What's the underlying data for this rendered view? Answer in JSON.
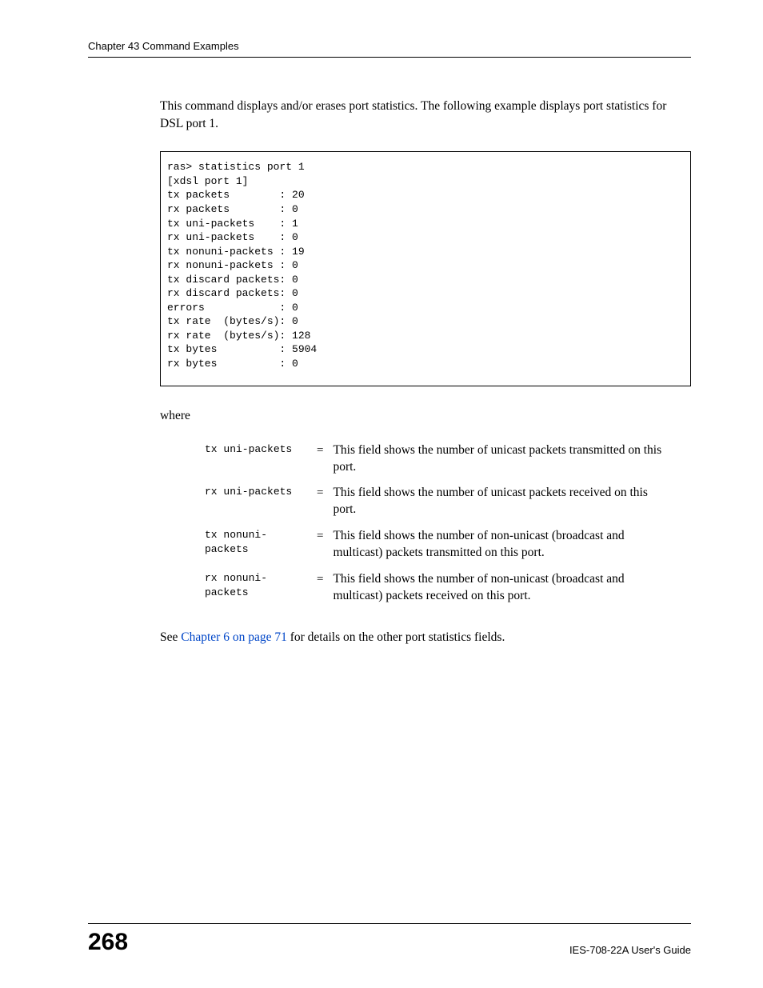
{
  "header": {
    "chapter": "Chapter 43 Command Examples"
  },
  "intro_paragraph": "This command displays and/or erases port statistics. The following example displays port statistics for DSL port 1.",
  "code_output": "ras> statistics port 1\n[xdsl port 1]\ntx packets        : 20\nrx packets        : 0\ntx uni-packets    : 1\nrx uni-packets    : 0\ntx nonuni-packets : 19\nrx nonuni-packets : 0\ntx discard packets: 0\nrx discard packets: 0\nerrors            : 0\ntx rate  (bytes/s): 0\nrx rate  (bytes/s): 128\ntx bytes          : 5904\nrx bytes          : 0",
  "where_label": "where",
  "definitions": [
    {
      "term": "tx uni-packets",
      "eq": "=",
      "desc": "This field shows the number of unicast packets transmitted on this port."
    },
    {
      "term": "rx uni-packets",
      "eq": "=",
      "desc": "This field shows the number of unicast packets received on this port."
    },
    {
      "term": "tx nonuni-\npackets",
      "eq": "=",
      "desc": "This field shows the number of non-unicast (broadcast and multicast) packets transmitted on this port."
    },
    {
      "term": "rx nonuni-\npackets",
      "eq": "=",
      "desc": "This field shows the number of non-unicast (broadcast and multicast) packets received on this port."
    }
  ],
  "see_prefix": "See ",
  "see_link": "Chapter 6 on page 71",
  "see_suffix": " for details on the other port statistics fields.",
  "footer": {
    "page": "268",
    "guide": "IES-708-22A User's Guide"
  }
}
